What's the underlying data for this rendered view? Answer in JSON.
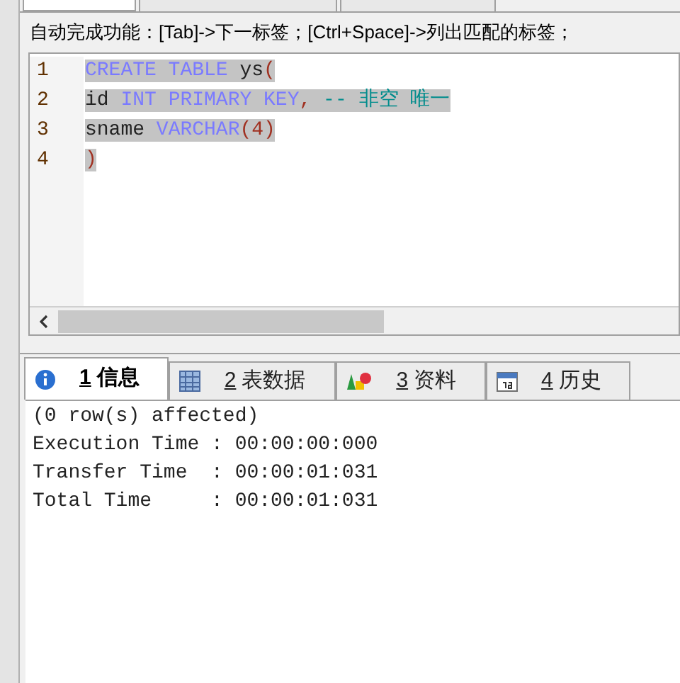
{
  "editor_tabs": [
    {
      "selected": true
    },
    {
      "selected": false
    },
    {
      "selected": false
    }
  ],
  "hint": "自动完成功能：[Tab]->下一标签；[Ctrl+Space]->列出匹配的标签；",
  "editor": {
    "lines": [
      {
        "number": "1",
        "tokens": [
          {
            "kind": "keyword",
            "text": "CREATE TABLE"
          },
          {
            "kind": "plain",
            "text": " ys"
          },
          {
            "kind": "paren",
            "text": "("
          }
        ]
      },
      {
        "number": "2",
        "tokens": [
          {
            "kind": "plain",
            "text": "id "
          },
          {
            "kind": "keyword",
            "text": "INT PRIMARY KEY"
          },
          {
            "kind": "paren",
            "text": ","
          },
          {
            "kind": "comment",
            "text": " -- 非空 唯一"
          }
        ]
      },
      {
        "number": "3",
        "tokens": [
          {
            "kind": "plain",
            "text": "sname "
          },
          {
            "kind": "keyword",
            "text": "VARCHAR"
          },
          {
            "kind": "paren",
            "text": "(4)"
          }
        ]
      },
      {
        "number": "4",
        "tokens": [
          {
            "kind": "paren",
            "text": ")"
          }
        ]
      }
    ]
  },
  "result_tabs": [
    {
      "kind": "info",
      "number": "1",
      "label": "信息",
      "selected": true
    },
    {
      "kind": "table",
      "number": "2",
      "label": "表数据",
      "selected": false
    },
    {
      "kind": "shapes",
      "number": "3",
      "label": "资料",
      "selected": false
    },
    {
      "kind": "calendar",
      "number": "4",
      "label": "历史",
      "selected": false
    }
  ],
  "output": [
    "(0 row(s) affected)",
    "Execution Time : 00:00:00:000",
    "Transfer Time  : 00:00:01:031",
    "Total Time     : 00:00:01:031"
  ]
}
